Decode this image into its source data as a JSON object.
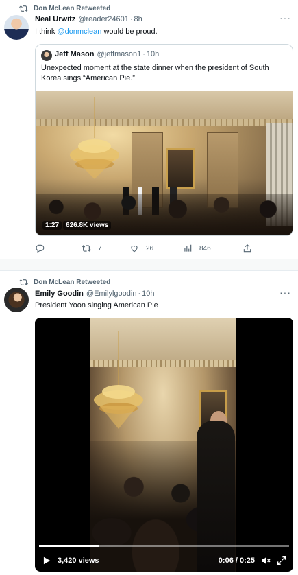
{
  "tweets": [
    {
      "retweeted_by": "Don McLean Retweeted",
      "author_name": "Neal Urwitz",
      "author_handle": "@reader24601",
      "time": "8h",
      "text_before": "I think ",
      "mention": "@donmclean",
      "text_after": " would be proud.",
      "quote": {
        "author_name": "Jeff Mason",
        "author_handle": "@jeffmason1",
        "time": "10h",
        "text": "Unexpected moment at the state dinner when the president of South Korea sings “American Pie.”",
        "video_duration": "1:27",
        "video_views": "626.8K views"
      },
      "actions": {
        "retweets": "7",
        "likes": "26",
        "views": "846"
      }
    },
    {
      "retweeted_by": "Don McLean Retweeted",
      "author_name": "Emily Goodin",
      "author_handle": "@Emilylgoodin",
      "time": "10h",
      "text": "President Yoon singing American Pie",
      "video": {
        "views": "3,420 views",
        "timecode": "0:06 / 0:25",
        "progress": 0.24
      }
    }
  ],
  "icons": {
    "retweet": "retweet-icon",
    "reply": "reply-icon",
    "like": "heart-icon",
    "views": "bar-chart-icon",
    "share": "share-icon",
    "more": "more-icon",
    "play": "play-icon",
    "mute": "mute-icon",
    "fullscreen": "fullscreen-icon"
  },
  "colors": {
    "accent": "#1d9bf0",
    "muted": "#536471",
    "text": "#0f1419"
  }
}
